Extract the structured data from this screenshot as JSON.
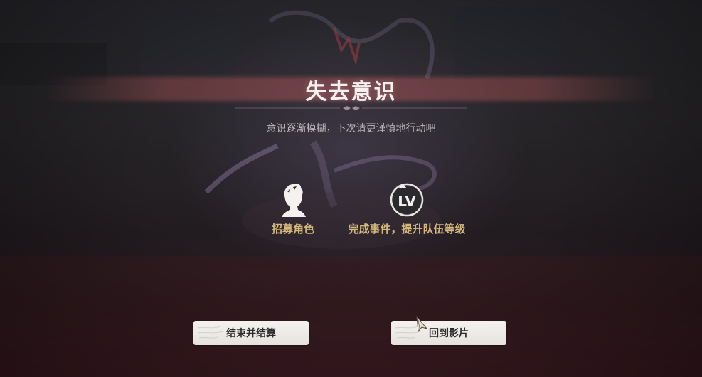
{
  "dialog": {
    "title": "失去意识",
    "subtitle": "意识逐渐模糊，下次请更谨慎地行动吧"
  },
  "options": [
    {
      "icon": "character-silhouette-icon",
      "label": "招募角色"
    },
    {
      "icon": "level-up-icon",
      "label": "完成事件，提升队伍等级",
      "icon_text": "LV"
    }
  ],
  "buttons": {
    "end_settle": "结束并结算",
    "return_film": "回到影片"
  },
  "colors": {
    "title": "#f6f1ee",
    "subtitle": "#bdb6b8",
    "option_label": "#d6b87a",
    "button_bg": "#f0eeeb",
    "title_band": "#c05c5c"
  }
}
